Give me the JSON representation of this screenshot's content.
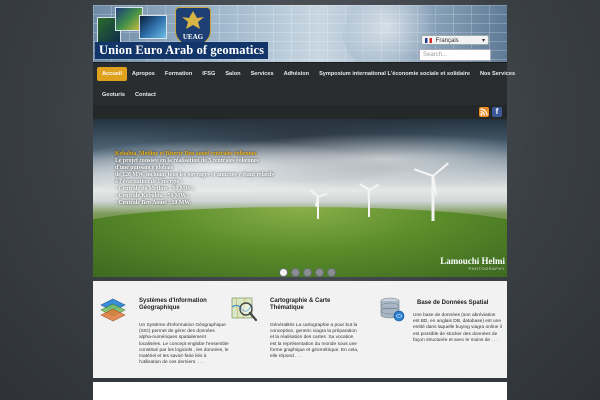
{
  "header": {
    "logo_text": "UEAG",
    "site_title": "Union Euro Arab of geomatics",
    "language": {
      "selected": "Français",
      "flag_colors": [
        "#233b8c",
        "#ffffff",
        "#d42a2a"
      ]
    },
    "search": {
      "placeholder": "Search..."
    }
  },
  "nav": {
    "accent": "#e0a21e",
    "row1": [
      {
        "label": "Accueil",
        "active": true
      },
      {
        "label": "Apropos"
      },
      {
        "label": "Formation"
      },
      {
        "label": "IFSG"
      },
      {
        "label": "Salon"
      },
      {
        "label": "Services"
      },
      {
        "label": "Adhésion"
      },
      {
        "label": "Symposium international L'économie sociale et solidaire"
      },
      {
        "label": "Nos Services"
      }
    ],
    "row2": [
      {
        "label": "Geoturis"
      },
      {
        "label": "Contact"
      }
    ]
  },
  "social": {
    "rss_icon": "rss-icon",
    "facebook_icon": "facebook-icon",
    "rss_color": "#f08a24",
    "facebook_color": "#3b5998"
  },
  "slider": {
    "headline": "Kebabta, Metline et Bizerte Ben aouel centrales éoliennes",
    "lines": [
      "Le projet consiste en la réalisation de 3 centrales éoliennes",
      "d'une puissance globale",
      "de 120 MW, incluant tous les ouvrages et annexes y étant relatifs",
      "à l'évacuation de l'énergie :",
      "- Centrale de Metline : 50 MW ;",
      "- Centrale Kebabta : 50 MW ;",
      "- Centrale Ben Aouel : 20 MW."
    ],
    "watermark_name": "Lamouchi Helmi",
    "watermark_sub": "PHOTOGRAPHY",
    "slide_count": 5,
    "active_slide": 1
  },
  "features": [
    {
      "title": "Systèmes d'Information Géographique",
      "icon": "sig-layers-icon",
      "text": "Un Système d'Information Géographique (SIG) permet de gérer des données alpha-numériques spatialement localisées. Le concept englobe l'ensemble constitué par les logiciels , les données, le matériel et les savoir-faire liés à l'utilisation de ces derniers. . . ."
    },
    {
      "title": "Cartographie & Carte Thématique",
      "icon": "map-magnifier-icon",
      "text": "Généralités La cartographie a pour but la conception, generic viagra la préparation et la réalisation des cartes. Sa vocation est la représentation du monde sous une forme graphique et géométrique. En cela, elle répond . . ."
    },
    {
      "title": "Base de Données Spatial",
      "icon": "database-icon",
      "text": "Une base de données (son abréviation est BD, en anglais DB, database) est une entité dans laquelle buying viagra online il est possible de stocker des données de façon structurée et avec le moins de . . ."
    }
  ]
}
